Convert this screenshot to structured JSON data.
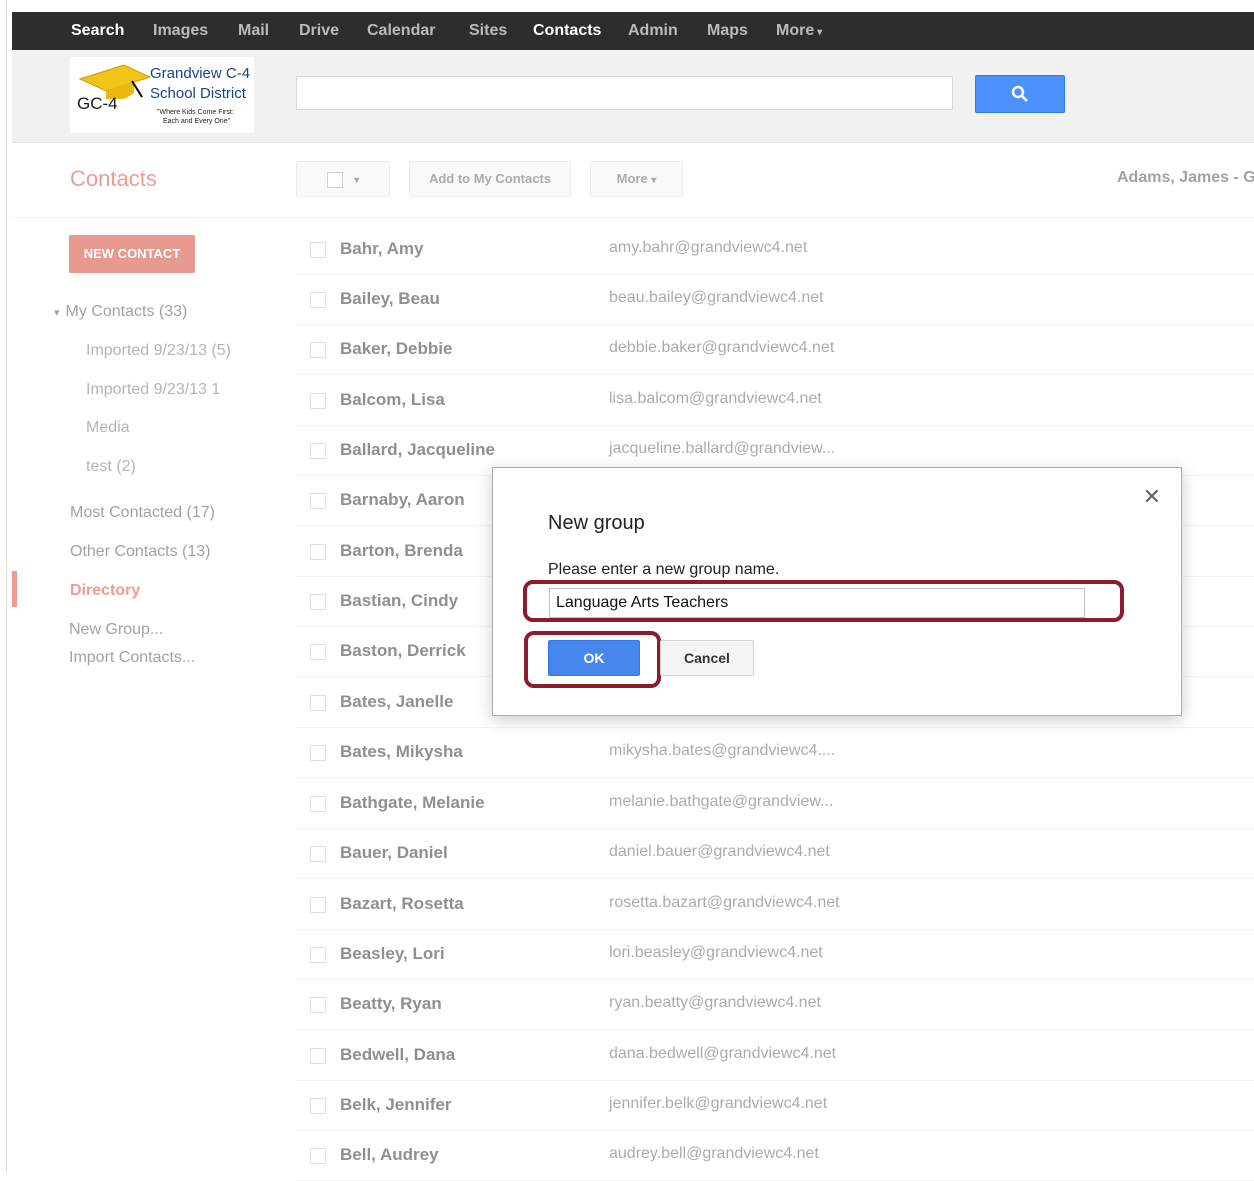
{
  "nav": {
    "items": [
      {
        "label": "Search",
        "active": true
      },
      {
        "label": "Images",
        "active": false
      },
      {
        "label": "Mail",
        "active": false
      },
      {
        "label": "Drive",
        "active": false
      },
      {
        "label": "Calendar",
        "active": false
      },
      {
        "label": "Sites",
        "active": false
      },
      {
        "label": "Contacts",
        "active": true
      },
      {
        "label": "Admin",
        "active": false
      },
      {
        "label": "Maps",
        "active": false
      },
      {
        "label": "More",
        "active": false
      }
    ]
  },
  "logo": {
    "abbr": "GC-4",
    "name_line1": "Grandview C-4",
    "name_line2": "School District",
    "tagline1": "\"Where Kids Come First:",
    "tagline2": "Each and Every One\""
  },
  "search": {
    "value": "",
    "icon": "search-icon",
    "button_color": "#4d90fe"
  },
  "toolbar": {
    "app_title": "Contacts",
    "add_to_contacts": "Add to My Contacts",
    "more": "More",
    "user": "Adams, James - G"
  },
  "sidebar": {
    "new_contact": "NEW CONTACT",
    "my_contacts": "My Contacts (33)",
    "groups": [
      "Imported 9/23/13 (5)",
      "Imported 9/23/13 1",
      "Media",
      "test (2)"
    ],
    "most_contacted": "Most Contacted (17)",
    "other_contacts": "Other Contacts (13)",
    "directory": "Directory",
    "new_group": "New Group...",
    "import_contacts": "Import Contacts..."
  },
  "contacts": [
    {
      "name": "Bahr, Amy",
      "email": "amy.bahr@grandviewc4.net"
    },
    {
      "name": "Bailey, Beau",
      "email": "beau.bailey@grandviewc4.net"
    },
    {
      "name": "Baker, Debbie",
      "email": "debbie.baker@grandviewc4.net"
    },
    {
      "name": "Balcom, Lisa",
      "email": "lisa.balcom@grandviewc4.net"
    },
    {
      "name": "Ballard, Jacqueline",
      "email": "jacqueline.ballard@grandview..."
    },
    {
      "name": "Barnaby, Aaron",
      "email": ""
    },
    {
      "name": "Barton, Brenda",
      "email": ""
    },
    {
      "name": "Bastian, Cindy",
      "email": ""
    },
    {
      "name": "Baston, Derrick",
      "email": ""
    },
    {
      "name": "Bates, Janelle",
      "email": ""
    },
    {
      "name": "Bates, Mikysha",
      "email": "mikysha.bates@grandviewc4...."
    },
    {
      "name": "Bathgate, Melanie",
      "email": "melanie.bathgate@grandview..."
    },
    {
      "name": "Bauer, Daniel",
      "email": "daniel.bauer@grandviewc4.net"
    },
    {
      "name": "Bazart, Rosetta",
      "email": "rosetta.bazart@grandviewc4.net"
    },
    {
      "name": "Beasley, Lori",
      "email": "lori.beasley@grandviewc4.net"
    },
    {
      "name": "Beatty, Ryan",
      "email": "ryan.beatty@grandviewc4.net"
    },
    {
      "name": "Bedwell, Dana",
      "email": "dana.bedwell@grandviewc4.net"
    },
    {
      "name": "Belk, Jennifer",
      "email": "jennifer.belk@grandviewc4.net"
    },
    {
      "name": "Bell, Audrey",
      "email": "audrey.bell@grandviewc4.net"
    }
  ],
  "dialog": {
    "title": "New group",
    "prompt": "Please enter a new group name.",
    "input_value": "Language Arts Teachers",
    "ok": "OK",
    "cancel": "Cancel",
    "close_icon": "close-icon",
    "highlight_color": "#8b1c2c"
  }
}
